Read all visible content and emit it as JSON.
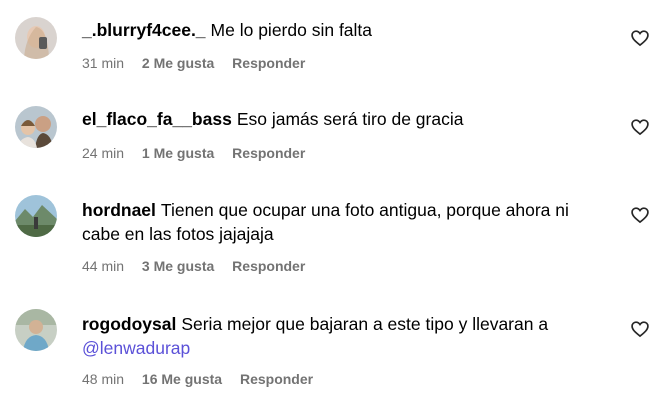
{
  "comments": [
    {
      "username": "_.blurryf4cee._",
      "text": "Me lo pierdo sin falta",
      "mention": "",
      "time": "31 min",
      "likes": "2 Me gusta",
      "reply": "Responder",
      "avatar_icon": "profile-photo"
    },
    {
      "username": "el_flaco_fa__bass",
      "text": "Eso jamás será tiro de gracia",
      "mention": "",
      "time": "24 min",
      "likes": "1 Me gusta",
      "reply": "Responder",
      "avatar_icon": "profile-photo"
    },
    {
      "username": "hordnael",
      "text": "Tienen que ocupar una foto antigua, porque ahora ni cabe en las fotos jajajaja",
      "mention": "",
      "time": "44 min",
      "likes": "3 Me gusta",
      "reply": "Responder",
      "avatar_icon": "profile-photo"
    },
    {
      "username": "rogodoysal",
      "text": "Seria mejor que bajaran a este tipo y llevaran a",
      "mention": "@lenwadurap",
      "time": "48 min",
      "likes": "16 Me gusta",
      "reply": "Responder",
      "avatar_icon": "profile-photo"
    }
  ],
  "icons": {
    "like": "heart-outline-icon"
  },
  "colors": {
    "meta": "#737373",
    "mention": "#5b51d8"
  }
}
